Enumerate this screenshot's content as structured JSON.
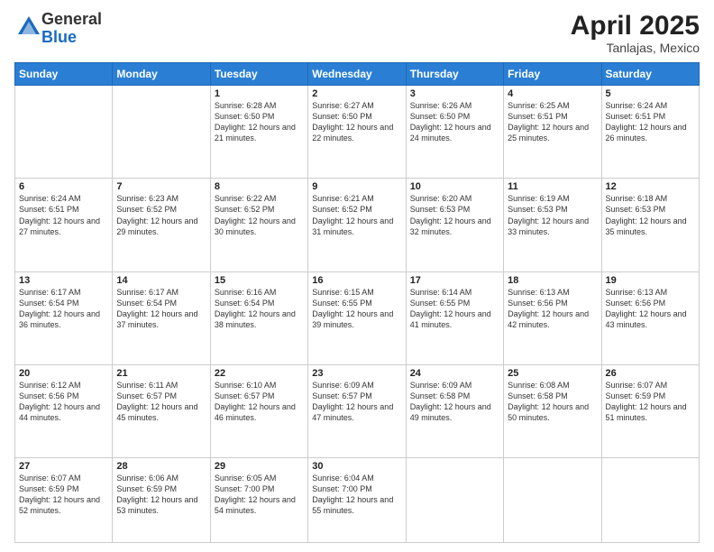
{
  "logo": {
    "general": "General",
    "blue": "Blue"
  },
  "header": {
    "month_year": "April 2025",
    "location": "Tanlajas, Mexico"
  },
  "weekdays": [
    "Sunday",
    "Monday",
    "Tuesday",
    "Wednesday",
    "Thursday",
    "Friday",
    "Saturday"
  ],
  "weeks": [
    [
      {
        "day": "",
        "info": ""
      },
      {
        "day": "",
        "info": ""
      },
      {
        "day": "1",
        "info": "Sunrise: 6:28 AM\nSunset: 6:50 PM\nDaylight: 12 hours and 21 minutes."
      },
      {
        "day": "2",
        "info": "Sunrise: 6:27 AM\nSunset: 6:50 PM\nDaylight: 12 hours and 22 minutes."
      },
      {
        "day": "3",
        "info": "Sunrise: 6:26 AM\nSunset: 6:50 PM\nDaylight: 12 hours and 24 minutes."
      },
      {
        "day": "4",
        "info": "Sunrise: 6:25 AM\nSunset: 6:51 PM\nDaylight: 12 hours and 25 minutes."
      },
      {
        "day": "5",
        "info": "Sunrise: 6:24 AM\nSunset: 6:51 PM\nDaylight: 12 hours and 26 minutes."
      }
    ],
    [
      {
        "day": "6",
        "info": "Sunrise: 6:24 AM\nSunset: 6:51 PM\nDaylight: 12 hours and 27 minutes."
      },
      {
        "day": "7",
        "info": "Sunrise: 6:23 AM\nSunset: 6:52 PM\nDaylight: 12 hours and 29 minutes."
      },
      {
        "day": "8",
        "info": "Sunrise: 6:22 AM\nSunset: 6:52 PM\nDaylight: 12 hours and 30 minutes."
      },
      {
        "day": "9",
        "info": "Sunrise: 6:21 AM\nSunset: 6:52 PM\nDaylight: 12 hours and 31 minutes."
      },
      {
        "day": "10",
        "info": "Sunrise: 6:20 AM\nSunset: 6:53 PM\nDaylight: 12 hours and 32 minutes."
      },
      {
        "day": "11",
        "info": "Sunrise: 6:19 AM\nSunset: 6:53 PM\nDaylight: 12 hours and 33 minutes."
      },
      {
        "day": "12",
        "info": "Sunrise: 6:18 AM\nSunset: 6:53 PM\nDaylight: 12 hours and 35 minutes."
      }
    ],
    [
      {
        "day": "13",
        "info": "Sunrise: 6:17 AM\nSunset: 6:54 PM\nDaylight: 12 hours and 36 minutes."
      },
      {
        "day": "14",
        "info": "Sunrise: 6:17 AM\nSunset: 6:54 PM\nDaylight: 12 hours and 37 minutes."
      },
      {
        "day": "15",
        "info": "Sunrise: 6:16 AM\nSunset: 6:54 PM\nDaylight: 12 hours and 38 minutes."
      },
      {
        "day": "16",
        "info": "Sunrise: 6:15 AM\nSunset: 6:55 PM\nDaylight: 12 hours and 39 minutes."
      },
      {
        "day": "17",
        "info": "Sunrise: 6:14 AM\nSunset: 6:55 PM\nDaylight: 12 hours and 41 minutes."
      },
      {
        "day": "18",
        "info": "Sunrise: 6:13 AM\nSunset: 6:56 PM\nDaylight: 12 hours and 42 minutes."
      },
      {
        "day": "19",
        "info": "Sunrise: 6:13 AM\nSunset: 6:56 PM\nDaylight: 12 hours and 43 minutes."
      }
    ],
    [
      {
        "day": "20",
        "info": "Sunrise: 6:12 AM\nSunset: 6:56 PM\nDaylight: 12 hours and 44 minutes."
      },
      {
        "day": "21",
        "info": "Sunrise: 6:11 AM\nSunset: 6:57 PM\nDaylight: 12 hours and 45 minutes."
      },
      {
        "day": "22",
        "info": "Sunrise: 6:10 AM\nSunset: 6:57 PM\nDaylight: 12 hours and 46 minutes."
      },
      {
        "day": "23",
        "info": "Sunrise: 6:09 AM\nSunset: 6:57 PM\nDaylight: 12 hours and 47 minutes."
      },
      {
        "day": "24",
        "info": "Sunrise: 6:09 AM\nSunset: 6:58 PM\nDaylight: 12 hours and 49 minutes."
      },
      {
        "day": "25",
        "info": "Sunrise: 6:08 AM\nSunset: 6:58 PM\nDaylight: 12 hours and 50 minutes."
      },
      {
        "day": "26",
        "info": "Sunrise: 6:07 AM\nSunset: 6:59 PM\nDaylight: 12 hours and 51 minutes."
      }
    ],
    [
      {
        "day": "27",
        "info": "Sunrise: 6:07 AM\nSunset: 6:59 PM\nDaylight: 12 hours and 52 minutes."
      },
      {
        "day": "28",
        "info": "Sunrise: 6:06 AM\nSunset: 6:59 PM\nDaylight: 12 hours and 53 minutes."
      },
      {
        "day": "29",
        "info": "Sunrise: 6:05 AM\nSunset: 7:00 PM\nDaylight: 12 hours and 54 minutes."
      },
      {
        "day": "30",
        "info": "Sunrise: 6:04 AM\nSunset: 7:00 PM\nDaylight: 12 hours and 55 minutes."
      },
      {
        "day": "",
        "info": ""
      },
      {
        "day": "",
        "info": ""
      },
      {
        "day": "",
        "info": ""
      }
    ]
  ]
}
